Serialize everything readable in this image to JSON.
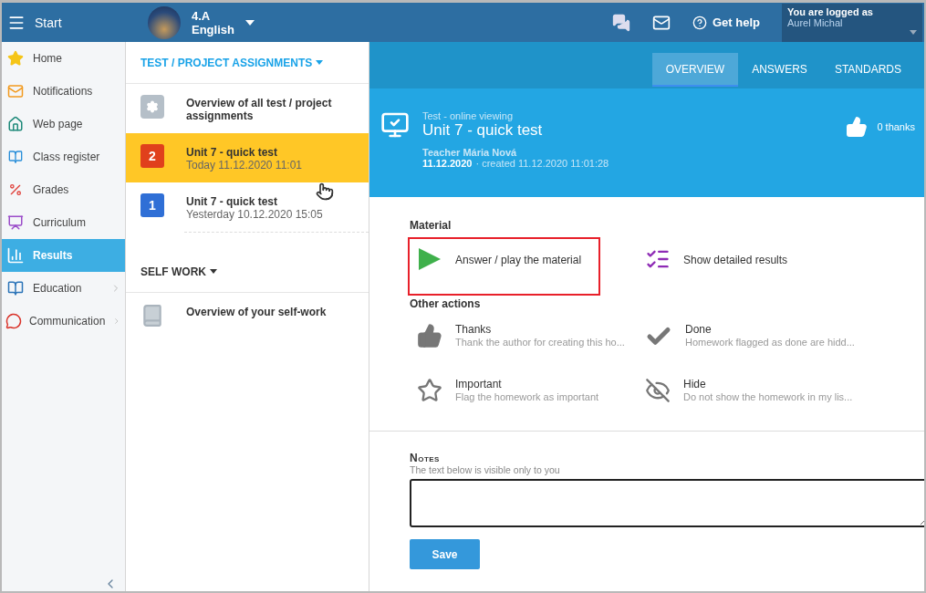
{
  "topbar": {
    "start": "Start",
    "class_name": "4.A",
    "subject": "English",
    "help": "Get help",
    "login_label": "You are logged as",
    "user": "Aurel Michal"
  },
  "sidebar": {
    "items": [
      {
        "label": "Home",
        "selected": false,
        "submenu": false
      },
      {
        "label": "Notifications",
        "selected": false,
        "submenu": false
      },
      {
        "label": "Web page",
        "selected": false,
        "submenu": false
      },
      {
        "label": "Class register",
        "selected": false,
        "submenu": false
      },
      {
        "label": "Grades",
        "selected": false,
        "submenu": false
      },
      {
        "label": "Curriculum",
        "selected": false,
        "submenu": false
      },
      {
        "label": "Results",
        "selected": true,
        "submenu": false
      },
      {
        "label": "Education",
        "selected": false,
        "submenu": true
      },
      {
        "label": "Communication",
        "selected": false,
        "submenu": true
      }
    ]
  },
  "assignments": {
    "heading": "TEST / PROJECT ASSIGNMENTS",
    "items": [
      {
        "kind": "overview",
        "title": "Overview of all test / project assignments",
        "selected": false
      },
      {
        "kind": "assignment",
        "badge": "2",
        "color": "#e0401c",
        "title": "Unit 7 - quick test",
        "date": "Today 11.12.2020 11:01",
        "selected": true
      },
      {
        "kind": "assignment",
        "badge": "1",
        "color": "#2f6fd6",
        "title": "Unit 7 - quick test",
        "date": "Yesterday 10.12.2020 15:05",
        "selected": false
      }
    ]
  },
  "self_work": {
    "heading": "SELF WORK",
    "items": [
      {
        "kind": "overview",
        "title": "Overview of your self-work",
        "selected": false
      }
    ]
  },
  "tabs": [
    {
      "label": "OVERVIEW",
      "selected": true
    },
    {
      "label": "ANSWERS",
      "selected": false
    },
    {
      "label": "STANDARDS",
      "selected": false
    }
  ],
  "detail": {
    "type": "Test - online viewing",
    "title": "Unit 7 - quick test",
    "teacher": "Teacher Mária Nová",
    "date": "11.12.2020",
    "created": "· created 11.12.2020 11:01:28",
    "thanks": "0 thanks"
  },
  "material": {
    "heading": "Material",
    "actions": [
      {
        "kind": "play",
        "label": "Answer / play the material",
        "highlighted": true
      },
      {
        "kind": "results",
        "label": "Show detailed results",
        "highlighted": false
      }
    ]
  },
  "other_actions": {
    "heading": "Other actions",
    "actions": [
      {
        "kind": "thanks",
        "label": "Thanks",
        "hint": "Thank the author for creating this ho..."
      },
      {
        "kind": "done",
        "label": "Done",
        "hint": "Homework flagged as done are hidd..."
      },
      {
        "kind": "important",
        "label": "Important",
        "hint": "Flag the homework as important"
      },
      {
        "kind": "hide",
        "label": "Hide",
        "hint": "Do not show the homework in my lis..."
      }
    ]
  },
  "notes": {
    "heading": "Notes",
    "hint": "The text below is visible only to you",
    "save": "Save"
  }
}
